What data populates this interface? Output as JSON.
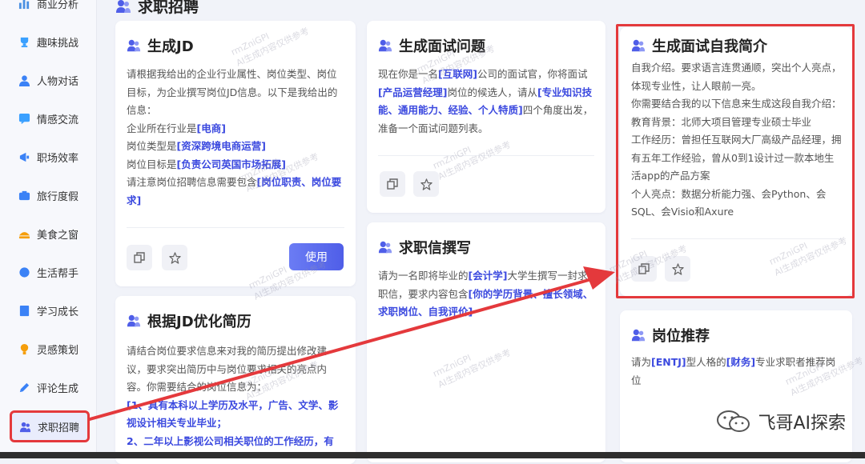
{
  "sidebar": {
    "items": [
      {
        "label": "商业分析",
        "icon": "chart-icon",
        "color": "#4a90e2"
      },
      {
        "label": "趣味挑战",
        "icon": "trophy-icon",
        "color": "#3aa0ff"
      },
      {
        "label": "人物对话",
        "icon": "person-icon",
        "color": "#3b82f6"
      },
      {
        "label": "情感交流",
        "icon": "heart-chat-icon",
        "color": "#3aa0ff"
      },
      {
        "label": "职场效率",
        "icon": "megaphone-icon",
        "color": "#3b82f6"
      },
      {
        "label": "旅行度假",
        "icon": "camera-icon",
        "color": "#3b82f6"
      },
      {
        "label": "美食之窗",
        "icon": "food-icon",
        "color": "#f59e0b"
      },
      {
        "label": "生活帮手",
        "icon": "helper-icon",
        "color": "#3b82f6"
      },
      {
        "label": "学习成长",
        "icon": "book-icon",
        "color": "#3b82f6"
      },
      {
        "label": "灵感策划",
        "icon": "bulb-icon",
        "color": "#f59e0b"
      },
      {
        "label": "评论生成",
        "icon": "pen-icon",
        "color": "#3b82f6"
      },
      {
        "label": "求职招聘",
        "icon": "people-icon",
        "color": "#4f5ee8"
      }
    ]
  },
  "main": {
    "title": "求职招聘"
  },
  "cards": {
    "jd": {
      "title": "生成JD",
      "lines": [
        [
          {
            "t": "请根据我给出的企业行业属性、岗位类型、岗位目标，为企业撰写岗位JD信息。以下是我给出的信息："
          }
        ],
        [
          {
            "t": "企业所在行业是"
          },
          {
            "t": "[电商]",
            "h": true
          }
        ],
        [
          {
            "t": "岗位类型是"
          },
          {
            "t": "[资深跨境电商运营]",
            "h": true
          }
        ],
        [
          {
            "t": "岗位目标是"
          },
          {
            "t": "[负责公司英国市场拓展]",
            "h": true
          }
        ],
        [
          {
            "t": "请注意岗位招聘信息需要包含"
          },
          {
            "t": "[岗位职责、岗位要求]",
            "h": true
          }
        ]
      ],
      "use_label": "使用"
    },
    "interview_q": {
      "title": "生成面试问题",
      "lines": [
        [
          {
            "t": "现在你是一名"
          },
          {
            "t": "[互联网]",
            "h": true
          },
          {
            "t": "公司的面试官，你将面试"
          },
          {
            "t": "[产品运营经理]",
            "h": true
          },
          {
            "t": "岗位的候选人，请从"
          },
          {
            "t": "[专业知识技能、通用能力、经验、个人特质]",
            "h": true
          },
          {
            "t": "四个角度出发，准备一个面试问题列表。"
          }
        ]
      ]
    },
    "self_intro": {
      "title": "生成面试自我简介",
      "lines": [
        [
          {
            "t": "自我介绍。要求语言连贯通顺，突出个人亮点，体现专业性，让人眼前一亮。"
          }
        ],
        [
          {
            "t": "你需要结合我的以下信息来生成这段自我介绍："
          }
        ],
        [
          {
            "t": "教育背景：北师大项目管理专业硕士毕业"
          }
        ],
        [
          {
            "t": "工作经历：曾担任互联网大厂高级产品经理，拥有五年工作经验，曾从0到1设计过一款本地生活app的产品方案"
          }
        ],
        [
          {
            "t": "个人亮点：数据分析能力强、会Python、会SQL、会Visio和Axure"
          }
        ]
      ]
    },
    "letter": {
      "title": "求职信撰写",
      "lines": [
        [
          {
            "t": "请为一名即将毕业的"
          },
          {
            "t": "[会计学]",
            "h": true
          },
          {
            "t": "大学生撰写一封求职信，要求内容包含"
          },
          {
            "t": "[你的学历背景、擅长领域、求职岗位、自我评价]",
            "h": true
          }
        ]
      ]
    },
    "resume": {
      "title": "根据JD优化简历",
      "lines": [
        [
          {
            "t": "请结合岗位要求信息来对我的简历提出修改建议，要求突出简历中与岗位要求相关的亮点内容。你需要结合的岗位信息为："
          }
        ],
        [
          {
            "t": "[1、具有本科以上学历及水平，广告、文学、影视设计相关专业毕业；",
            "h": true
          }
        ],
        [
          {
            "t": "2、二年以上影视公司相关职位的工作经历，有",
            "h": true
          }
        ]
      ]
    },
    "recommend": {
      "title": "岗位推荐",
      "lines": [
        [
          {
            "t": "请为"
          },
          {
            "t": "[ENTJ]",
            "h": true
          },
          {
            "t": "型人格的"
          },
          {
            "t": "[财务]",
            "h": true
          },
          {
            "t": "专业求职者推荐岗位"
          }
        ]
      ]
    }
  },
  "watermark": {
    "line1": "rmZniGPI",
    "line2": "AI生成内容仅供参考"
  },
  "wechat": {
    "name": "飞哥AI探索"
  },
  "colors": {
    "accent": "#4f5ee8",
    "highlight": "#3b49df",
    "annotation": "#e4393c"
  }
}
